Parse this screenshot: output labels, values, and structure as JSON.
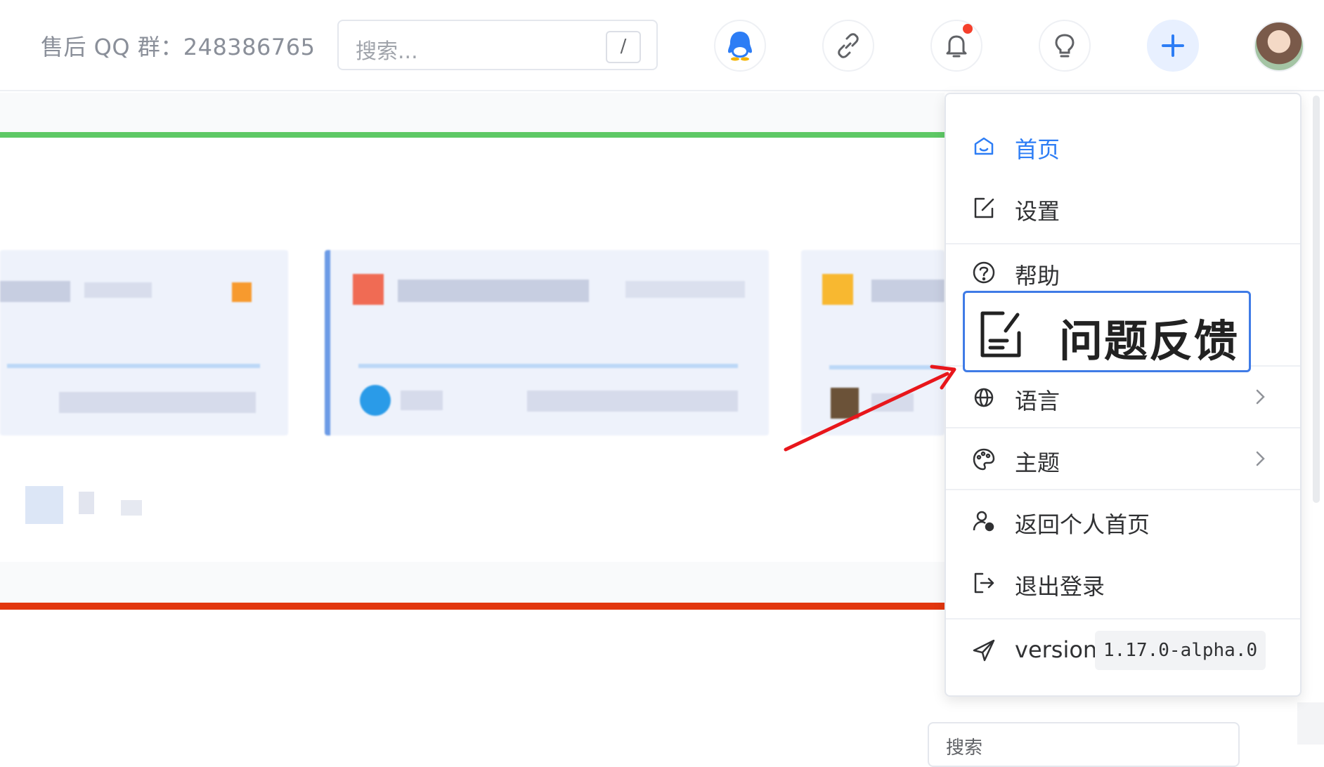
{
  "header": {
    "support_text": "售后 QQ 群：248386765",
    "search_placeholder": "搜索...",
    "search_shortcut": "/",
    "icons": [
      "qq-icon",
      "link-icon",
      "bell-icon",
      "bulb-icon",
      "plus-icon"
    ],
    "notification_dot_color": "#f5402c"
  },
  "menu": {
    "items": [
      {
        "label": "首页",
        "icon": "home-icon",
        "active": true
      },
      {
        "label": "设置",
        "icon": "edit-icon"
      },
      {
        "label": "帮助",
        "icon": "help-circle-icon"
      },
      {
        "label": "语言",
        "icon": "globe-icon",
        "submenu": true
      },
      {
        "label": "主题",
        "icon": "palette-icon",
        "submenu": true
      },
      {
        "label": "返回个人首页",
        "icon": "user-home-icon"
      },
      {
        "label": "退出登录",
        "icon": "logout-icon"
      }
    ],
    "version_label": "version",
    "version_value": "1.17.0-alpha.0"
  },
  "popup": {
    "label": "问题反馈",
    "icon": "feedback-icon"
  },
  "bottom_search": {
    "placeholder": "搜索"
  },
  "colors": {
    "accent": "#2d7df5",
    "green_bar": "#5ec865",
    "red_bar": "#e2360e",
    "annotation_arrow": "#e8161b"
  }
}
